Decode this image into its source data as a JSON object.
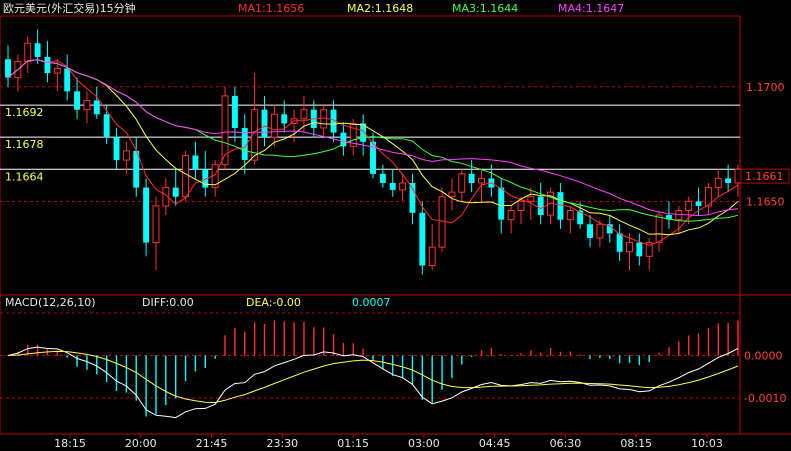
{
  "header": {
    "title": "欧元美元(外汇交易)15分钟",
    "ma": [
      {
        "label": "MA1:1.1656",
        "color": "#ff3030"
      },
      {
        "label": "MA2:1.1648",
        "color": "#ffff40"
      },
      {
        "label": "MA3:1.1644",
        "color": "#40ff40"
      },
      {
        "label": "MA4:1.1647",
        "color": "#ff40ff"
      }
    ]
  },
  "macd": {
    "label": "MACD(12,26,10)",
    "diff": "DIFF:0.00",
    "dea": "DEA:-0.00",
    "macd": "0.0007"
  },
  "colors": {
    "up": "#ff3030",
    "down": "#00ffff",
    "grid": "#c00000",
    "hline": "#ffffff",
    "diff": "#ffffff",
    "dea": "#ffff40"
  },
  "chart_data": {
    "type": "candlestick",
    "price_axis": {
      "range": [
        1.161,
        1.173
      ],
      "ticks": [
        {
          "value": 1.17,
          "label": "1.1700"
        },
        {
          "value": 1.165,
          "label": "1.1650"
        }
      ],
      "current": {
        "value": 1.1661,
        "label": "1.1661"
      }
    },
    "reference_lines": [
      {
        "value": 1.1692,
        "label": "1.1692"
      },
      {
        "value": 1.1678,
        "label": "1.1678"
      },
      {
        "value": 1.1664,
        "label": "1.1664"
      }
    ],
    "time_labels": [
      "18:15",
      "20:00",
      "21:45",
      "23:30",
      "01:15",
      "03:00",
      "04:45",
      "06:30",
      "08:15",
      "10:03"
    ],
    "candles": [
      [
        1.1712,
        1.1718,
        1.17,
        1.1704
      ],
      [
        1.1704,
        1.1714,
        1.1698,
        1.1711
      ],
      [
        1.1711,
        1.1722,
        1.1706,
        1.1719
      ],
      [
        1.1719,
        1.1725,
        1.171,
        1.1713
      ],
      [
        1.1713,
        1.172,
        1.1702,
        1.1706
      ],
      [
        1.1706,
        1.1712,
        1.1698,
        1.1708
      ],
      [
        1.1708,
        1.1714,
        1.1694,
        1.1698
      ],
      [
        1.1698,
        1.1704,
        1.1686,
        1.169
      ],
      [
        1.169,
        1.1698,
        1.1684,
        1.1694
      ],
      [
        1.1694,
        1.17,
        1.1686,
        1.1688
      ],
      [
        1.1688,
        1.1692,
        1.1675,
        1.1678
      ],
      [
        1.1678,
        1.1682,
        1.1664,
        1.1668
      ],
      [
        1.1668,
        1.1676,
        1.1662,
        1.1672
      ],
      [
        1.1672,
        1.1678,
        1.1652,
        1.1656
      ],
      [
        1.1656,
        1.166,
        1.1626,
        1.1632
      ],
      [
        1.1632,
        1.1652,
        1.162,
        1.1648
      ],
      [
        1.1648,
        1.166,
        1.1644,
        1.1656
      ],
      [
        1.1656,
        1.1664,
        1.1648,
        1.1652
      ],
      [
        1.1652,
        1.1672,
        1.165,
        1.167
      ],
      [
        1.167,
        1.1676,
        1.166,
        1.1664
      ],
      [
        1.1664,
        1.1672,
        1.1652,
        1.1656
      ],
      [
        1.1656,
        1.1668,
        1.1652,
        1.1666
      ],
      [
        1.1666,
        1.17,
        1.1664,
        1.1696
      ],
      [
        1.1696,
        1.17,
        1.1676,
        1.1682
      ],
      [
        1.1682,
        1.1688,
        1.1662,
        1.1668
      ],
      [
        1.1668,
        1.1706,
        1.1666,
        1.169
      ],
      [
        1.169,
        1.1696,
        1.1674,
        1.1678
      ],
      [
        1.1678,
        1.1692,
        1.1674,
        1.1688
      ],
      [
        1.1688,
        1.1694,
        1.168,
        1.1684
      ],
      [
        1.1684,
        1.169,
        1.1676,
        1.1686
      ],
      [
        1.1686,
        1.1696,
        1.168,
        1.169
      ],
      [
        1.169,
        1.1694,
        1.1678,
        1.1682
      ],
      [
        1.1682,
        1.1692,
        1.1678,
        1.169
      ],
      [
        1.169,
        1.1694,
        1.1676,
        1.168
      ],
      [
        1.168,
        1.1684,
        1.167,
        1.1674
      ],
      [
        1.1674,
        1.1686,
        1.167,
        1.1684
      ],
      [
        1.1684,
        1.1688,
        1.167,
        1.1676
      ],
      [
        1.1676,
        1.168,
        1.166,
        1.1662
      ],
      [
        1.1662,
        1.1666,
        1.1656,
        1.1658
      ],
      [
        1.1658,
        1.1664,
        1.1652,
        1.1655
      ],
      [
        1.1655,
        1.1662,
        1.165,
        1.1658
      ],
      [
        1.1658,
        1.1662,
        1.164,
        1.1645
      ],
      [
        1.1645,
        1.165,
        1.1618,
        1.1622
      ],
      [
        1.1622,
        1.164,
        1.162,
        1.163
      ],
      [
        1.163,
        1.1656,
        1.1628,
        1.1652
      ],
      [
        1.1652,
        1.166,
        1.1646,
        1.1654
      ],
      [
        1.1654,
        1.1664,
        1.165,
        1.1662
      ],
      [
        1.1662,
        1.1668,
        1.1654,
        1.1658
      ],
      [
        1.1658,
        1.1664,
        1.165,
        1.166
      ],
      [
        1.166,
        1.1666,
        1.1652,
        1.1656
      ],
      [
        1.1656,
        1.166,
        1.1636,
        1.1642
      ],
      [
        1.1642,
        1.1648,
        1.1636,
        1.1646
      ],
      [
        1.1646,
        1.1652,
        1.164,
        1.165
      ],
      [
        1.165,
        1.1656,
        1.1642,
        1.1652
      ],
      [
        1.1652,
        1.1658,
        1.164,
        1.1644
      ],
      [
        1.1644,
        1.1656,
        1.164,
        1.1654
      ],
      [
        1.1654,
        1.1658,
        1.1638,
        1.1642
      ],
      [
        1.1642,
        1.1648,
        1.1636,
        1.1646
      ],
      [
        1.1646,
        1.165,
        1.1638,
        1.164
      ],
      [
        1.164,
        1.1644,
        1.163,
        1.1634
      ],
      [
        1.1634,
        1.1642,
        1.163,
        1.164
      ],
      [
        1.164,
        1.1644,
        1.1632,
        1.1636
      ],
      [
        1.1636,
        1.164,
        1.1624,
        1.1628
      ],
      [
        1.1628,
        1.1636,
        1.162,
        1.1632
      ],
      [
        1.1632,
        1.1636,
        1.1622,
        1.1626
      ],
      [
        1.1626,
        1.1634,
        1.162,
        1.1632
      ],
      [
        1.1632,
        1.1646,
        1.1628,
        1.1644
      ],
      [
        1.1644,
        1.165,
        1.1638,
        1.1642
      ],
      [
        1.1642,
        1.1648,
        1.1636,
        1.1646
      ],
      [
        1.1646,
        1.1652,
        1.164,
        1.165
      ],
      [
        1.165,
        1.1656,
        1.1644,
        1.1648
      ],
      [
        1.1648,
        1.1658,
        1.1644,
        1.1656
      ],
      [
        1.1656,
        1.1664,
        1.1652,
        1.166
      ],
      [
        1.166,
        1.1666,
        1.1654,
        1.1658
      ],
      [
        1.1658,
        1.1666,
        1.1652,
        1.1664
      ]
    ],
    "ma_periods": [
      5,
      10,
      20,
      30
    ],
    "macd_axis": {
      "range": [
        -0.0018,
        0.001
      ],
      "ticks": [
        {
          "value": 0.0,
          "label": "0.0000"
        },
        {
          "value": -0.001,
          "label": "-0.0010"
        }
      ]
    }
  }
}
